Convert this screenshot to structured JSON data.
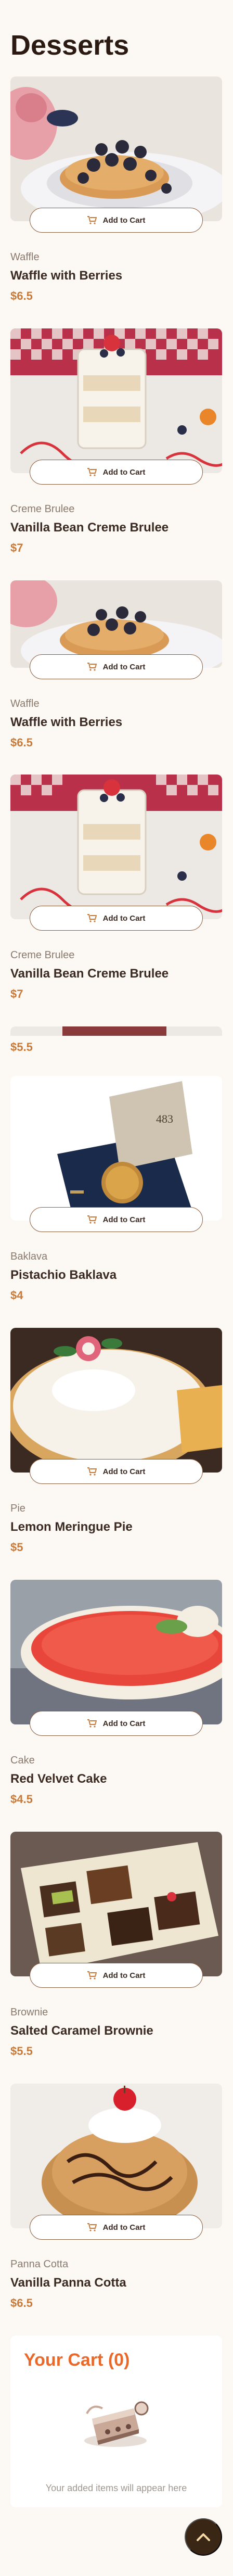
{
  "page": {
    "title": "Desserts"
  },
  "add_label": "Add to Cart",
  "items": [
    {
      "category": "Waffle",
      "name": "Waffle with Berries",
      "price": "$6.5",
      "image": "waffle"
    },
    {
      "category": "Creme Brulee",
      "name": "Vanilla Bean Creme Brulee",
      "price": "$7",
      "image": "brulee"
    },
    {
      "category": "Waffle",
      "name": "Waffle with Berries",
      "price": "$6.5",
      "image": "waffle"
    },
    {
      "category": "Creme Brulee",
      "name": "Vanilla Bean Creme Brulee",
      "price": "$7",
      "image": "brulee"
    },
    {
      "price": "$5.5"
    },
    {
      "category": "Baklava",
      "name": "Pistachio Baklava",
      "price": "$4",
      "image": "baklava"
    },
    {
      "category": "Pie",
      "name": "Lemon Meringue Pie",
      "price": "$5",
      "image": "pie"
    },
    {
      "category": "Cake",
      "name": "Red Velvet Cake",
      "price": "$4.5",
      "image": "cake"
    },
    {
      "category": "Brownie",
      "name": "Salted Caramel Brownie",
      "price": "$5.5",
      "image": "brownie"
    },
    {
      "category": "Panna Cotta",
      "name": "Vanilla Panna Cotta",
      "price": "$6.5",
      "image": "pannacotta"
    }
  ],
  "cart": {
    "title": "Your Cart (0)",
    "empty_text": "Your added items will appear here"
  },
  "colors": {
    "accent": "#e8692a",
    "price": "#c87a3a",
    "button_border": "#8a5a3a",
    "scroll_button": "#3a2614"
  },
  "icons": {
    "cart": "shopping-cart-icon",
    "scroll_top": "chevron-up-icon"
  }
}
